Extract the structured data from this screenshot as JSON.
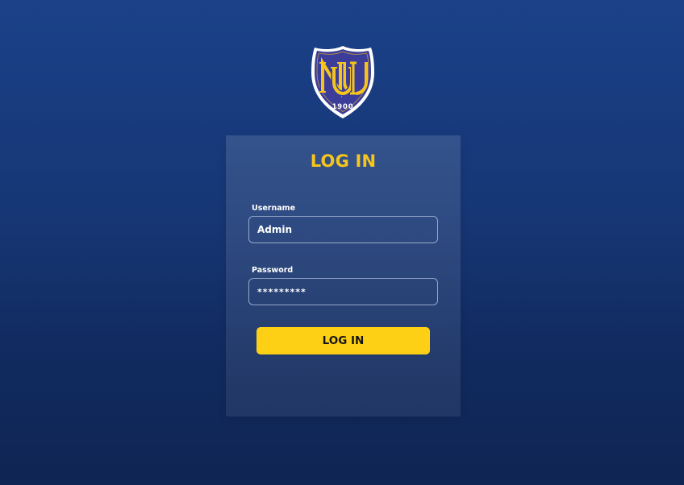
{
  "logo": {
    "monogram": "NU",
    "year": "1900",
    "colors": {
      "shield": "#3c3d99",
      "border": "#ffffff",
      "accent": "#f6c51c"
    }
  },
  "login_form": {
    "title": "LOG IN",
    "username": {
      "label": "Username",
      "value": "Admin"
    },
    "password": {
      "label": "Password",
      "value": "*********"
    },
    "submit_label": "LOG IN"
  },
  "colors": {
    "background_top": "#1b4189",
    "background_bottom": "#0f2553",
    "title": "#f6c51c",
    "button": "#fdd016",
    "button_text": "#141414"
  }
}
